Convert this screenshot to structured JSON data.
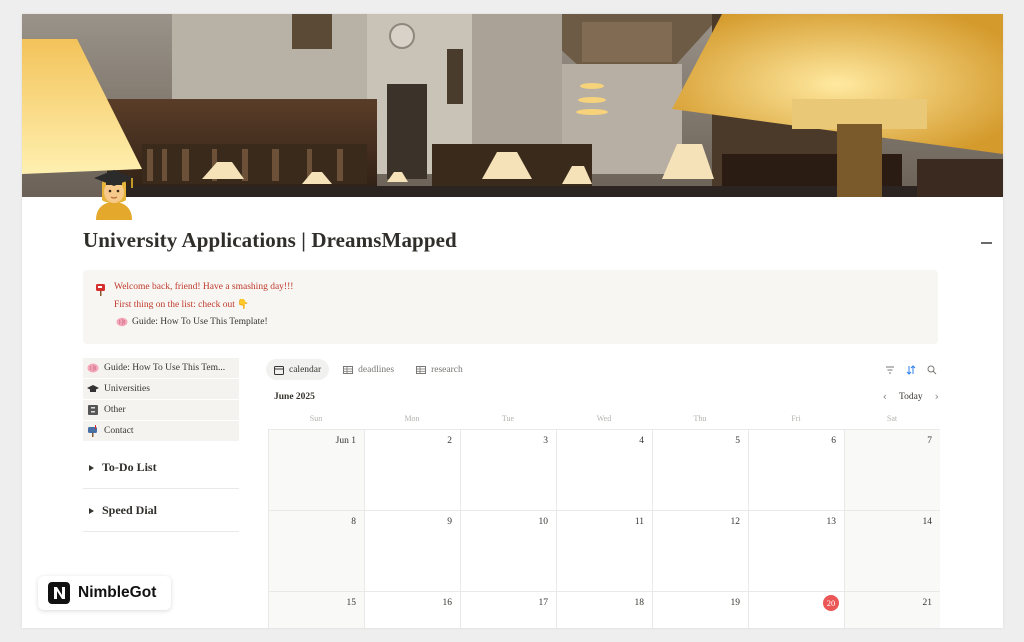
{
  "page": {
    "title": "University Applications | DreamsMapped",
    "icon": "student-emoji-icon"
  },
  "callout": {
    "icon": "mailbox-icon",
    "line1": "Welcome back, friend! Have a smashing day!!!",
    "line2": "First thing on the list: check out 👇",
    "guide_label": "Guide: How To Use This Template!",
    "guide_icon": "brain-icon",
    "text_color": "#c0392b"
  },
  "sidebar": {
    "items": [
      {
        "label": "Guide: How To Use This Tem...",
        "icon": "brain-icon"
      },
      {
        "label": "Universities",
        "icon": "graduation-cap-icon"
      },
      {
        "label": "Other",
        "icon": "file-cabinet-icon"
      },
      {
        "label": "Contact",
        "icon": "mailbox-icon"
      }
    ],
    "toggles": [
      {
        "label": "To-Do List"
      },
      {
        "label": "Speed Dial"
      }
    ]
  },
  "views": {
    "tabs": [
      {
        "label": "calendar",
        "icon": "calendar-icon",
        "active": true
      },
      {
        "label": "deadlines",
        "icon": "table-icon",
        "active": false
      },
      {
        "label": "research",
        "icon": "table-icon",
        "active": false
      }
    ],
    "tools": [
      "filter-icon",
      "sort-icon",
      "search-icon"
    ]
  },
  "calendar": {
    "month": "June 2025",
    "today_label": "Today",
    "weekdays": [
      "Sun",
      "Mon",
      "Tue",
      "Wed",
      "Thu",
      "Fri",
      "Sat"
    ],
    "weeks": [
      [
        "Jun 1",
        "2",
        "3",
        "4",
        "5",
        "6",
        "7"
      ],
      [
        "8",
        "9",
        "10",
        "11",
        "12",
        "13",
        "14"
      ],
      [
        "15",
        "16",
        "17",
        "18",
        "19",
        "20",
        "21"
      ]
    ],
    "today": "20",
    "today_color": "#eb5757"
  },
  "watermark": {
    "text": "NimbleGot"
  }
}
